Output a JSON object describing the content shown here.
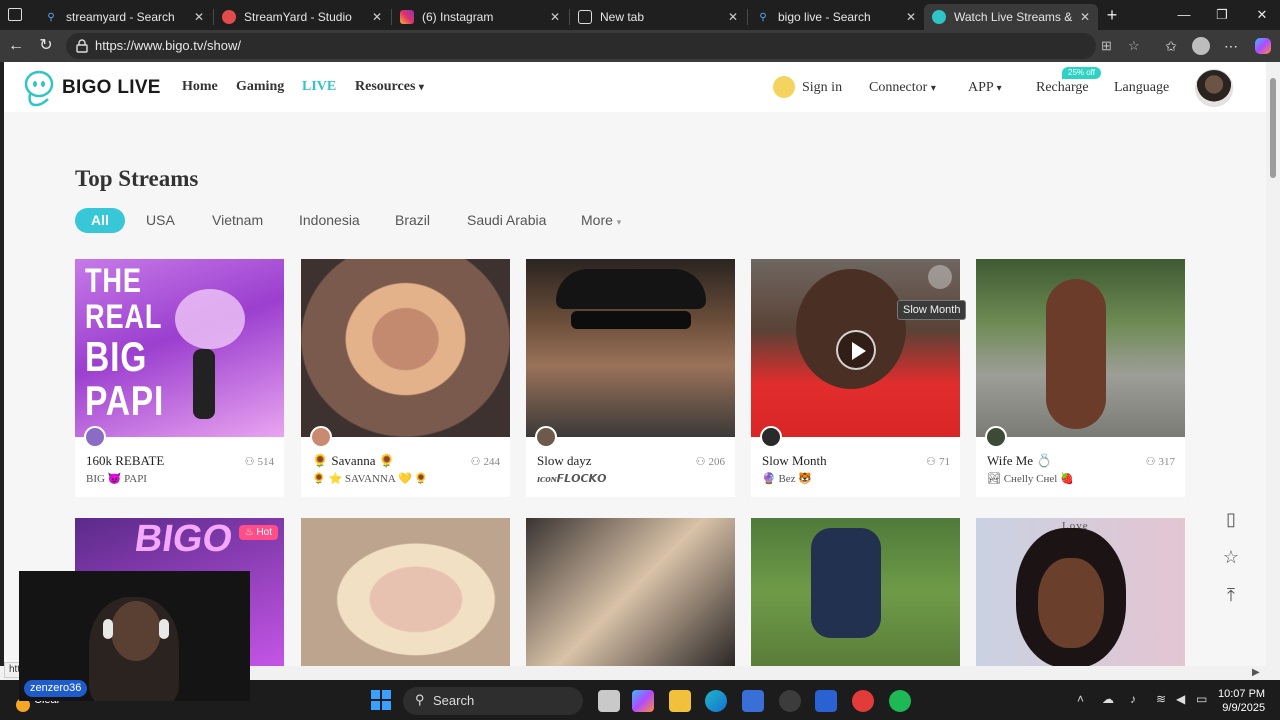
{
  "browser": {
    "tabs": [
      {
        "title": "streamyard - Search",
        "icon": "bing-search-icon"
      },
      {
        "title": "StreamYard - Studio",
        "icon": "streamyard-icon"
      },
      {
        "title": "(6) Instagram",
        "icon": "instagram-icon"
      },
      {
        "title": "New tab",
        "icon": "new-tab-icon"
      },
      {
        "title": "bigo live - Search",
        "icon": "bing-search-icon"
      },
      {
        "title": "Watch Live Streams & Live S",
        "icon": "bigo-icon"
      }
    ],
    "url": "https://www.bigo.tv/show/",
    "status_url": "htt"
  },
  "site": {
    "brand": "BIGO LIVE",
    "nav": {
      "home": "Home",
      "gaming": "Gaming",
      "live": "LIVE",
      "resources": "Resources"
    },
    "right_nav": {
      "signin": "Sign in",
      "connector": "Connector",
      "app": "APP",
      "recharge": "Recharge",
      "recharge_badge": "25% off",
      "language": "Language"
    },
    "accent_color": "#2ec5c6"
  },
  "main": {
    "title": "Top Streams",
    "filters": [
      "All",
      "USA",
      "Vietnam",
      "Indonesia",
      "Brazil",
      "Saudi Arabia",
      "More"
    ],
    "active_filter": "All",
    "tooltip": "Slow Month",
    "hot_label": "Hot",
    "streams": [
      {
        "name": "160k REBATE",
        "viewers": "514",
        "sub": "BIG 😈 PAPI"
      },
      {
        "name": "🌻 Savanna 🌻",
        "viewers": "244",
        "sub": "🌻 ⭐ SAVANNA 💛 🌻"
      },
      {
        "name": "Slow dayz",
        "viewers": "206",
        "sub": "ɪᴄᴏɴ𝙁𝙇𝙊𝘾𝙆𝙊"
      },
      {
        "name": "Slow Month",
        "viewers": "71",
        "sub": "🔮 Bez 🐯"
      },
      {
        "name": "Wife Me 💍",
        "viewers": "317",
        "sub": "🏞 Cнelly Cнel 🍓"
      }
    ],
    "thumb1_text": {
      "line1": "THE",
      "line2": "REAL",
      "line3": "BIG",
      "line4": "PAPI"
    },
    "row2_thumb1_text": "BIGO",
    "row2_thumb5_text": "Love"
  },
  "overlay": {
    "cam_user": "zenzero36"
  },
  "taskbar": {
    "weather": "Clear",
    "search": "Search",
    "time": "10:07 PM",
    "date": "9/9/2025"
  }
}
